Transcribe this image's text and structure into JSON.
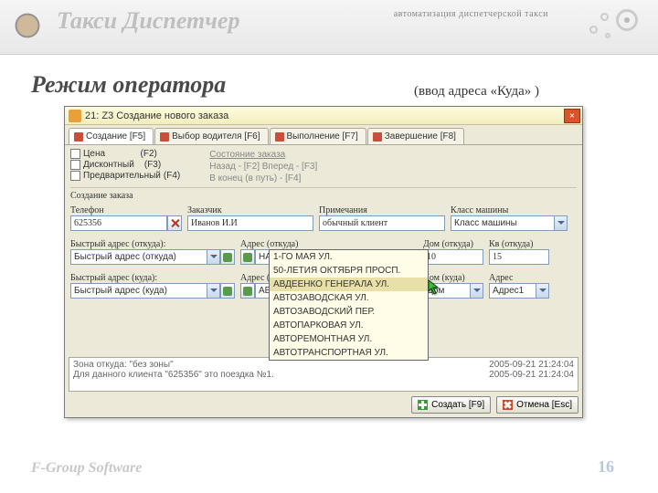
{
  "header": {
    "brand": "Такси Диспетчер",
    "tagline": "автоматизация диспетчерской такси"
  },
  "slide": {
    "title": "Режим оператора",
    "subtitle": "(ввод адреса «Куда» )"
  },
  "window": {
    "title": "21: Z3 Создание нового заказа",
    "tabs": [
      {
        "label": "Создание [F5]"
      },
      {
        "label": "Выбор водителя [F6]"
      },
      {
        "label": "Выполнение [F7]"
      },
      {
        "label": "Завершение [F8]"
      }
    ],
    "options": {
      "price": {
        "label": "Цена",
        "hotkey": "(F2)"
      },
      "discount": {
        "label": "Дисконтный",
        "hotkey": "(F3)"
      },
      "prelim": {
        "label": "Предварительный",
        "hotkey": "(F4)"
      }
    },
    "status": {
      "heading": "Состояние заказа",
      "back": "Назад - [F2]  Вперед - [F3]",
      "end": "В конец (в путь) -            [F4]"
    },
    "section_create": "Создание заказа",
    "labels": {
      "phone": "Телефон",
      "customer": "Заказчик",
      "notes": "Примечания",
      "car_class": "Класс машины",
      "quick_from": "Быстрый адрес (откуда):",
      "addr_from": "Адрес (откуда)",
      "house_from": "Дом (откуда)",
      "apt_from": "Кв (откуда)",
      "quick_to": "Быстрый адрес (куда):",
      "addr_to": "Адрес (куда)",
      "house_to": "Дом (куда)",
      "addr2": "Адрес"
    },
    "values": {
      "phone": "625356",
      "customer": "Иванов И.И",
      "notes": "обычный клиент",
      "car_class": "Класс машины",
      "quick_from": "Быстрый адрес (откуда)",
      "addr_from": "НАБЕРЕЖНЫЙ ПЕР.",
      "house_from": "10",
      "apt_from": "15",
      "quick_to": "Быстрый адрес (куда)",
      "addr_to": "АВДЕЕНКО ГЕНЕРАЛА УЛ.",
      "house_to": "Дом",
      "addr2": "Адрес1"
    },
    "dropdown_options": [
      "1-ГО МАЯ УЛ.",
      "50-ЛЕТИЯ ОКТЯБРЯ ПРОСП.",
      "АВДЕЕНКО ГЕНЕРАЛА УЛ.",
      "АВТОЗАВОДСКАЯ УЛ.",
      "АВТОЗАВОДСКИЙ ПЕР.",
      "АВТОПАРКОВАЯ УЛ.",
      "АВТОРЕМОНТНАЯ УЛ.",
      "АВТОТРАНСПОРТНАЯ УЛ."
    ],
    "log": {
      "line1": "Зона откуда: \"без зоны\"",
      "line2": "Для данного клиента \"625356\" это поездка №1.",
      "ts1": "2005-09-21  21:24:04",
      "ts2": "2005-09-21  21:24:04"
    },
    "buttons": {
      "create": "Создать [F9]",
      "cancel": "Отмена [Esc]"
    }
  },
  "footer": {
    "left": "F-Group Software",
    "page": "16"
  }
}
